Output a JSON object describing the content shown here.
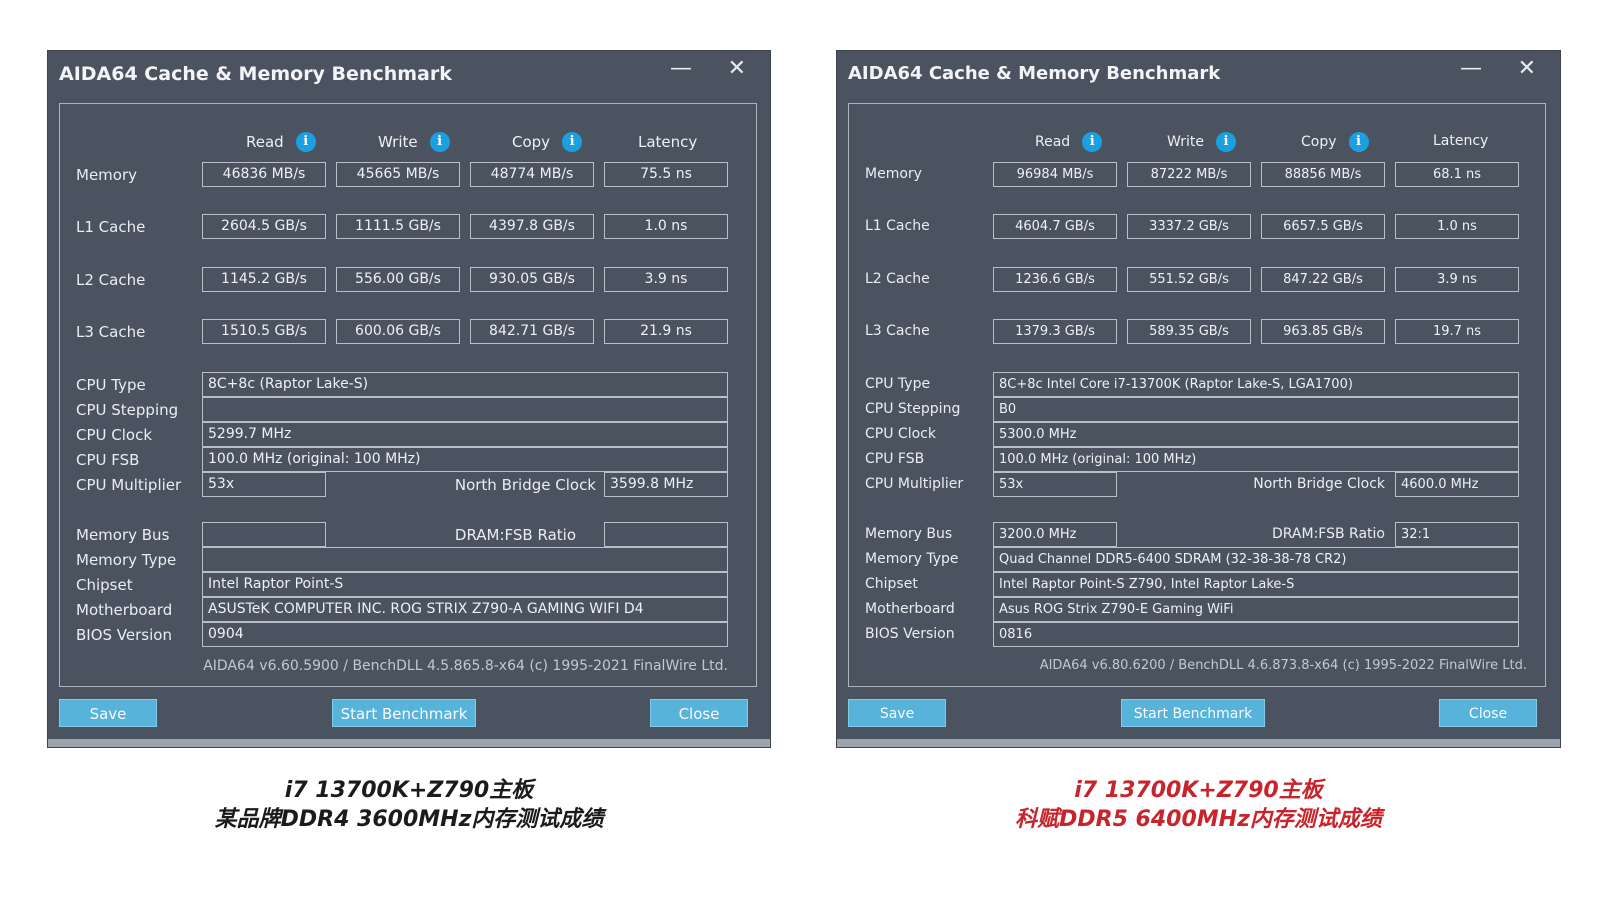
{
  "windows": [
    {
      "title": "AIDA64 Cache & Memory Benchmark",
      "min_glyph": "—",
      "close_glyph": "✕",
      "headers": [
        "Read",
        "Write",
        "Copy",
        "Latency"
      ],
      "info_glyph": "i",
      "rows": [
        {
          "label": "Memory",
          "values": [
            "46836 MB/s",
            "45665 MB/s",
            "48774 MB/s",
            "75.5 ns"
          ]
        },
        {
          "label": "L1 Cache",
          "values": [
            "2604.5 GB/s",
            "1111.5 GB/s",
            "4397.8 GB/s",
            "1.0 ns"
          ]
        },
        {
          "label": "L2 Cache",
          "values": [
            "1145.2 GB/s",
            "556.00 GB/s",
            "930.05 GB/s",
            "3.9 ns"
          ]
        },
        {
          "label": "L3 Cache",
          "values": [
            "1510.5 GB/s",
            "600.06 GB/s",
            "842.71 GB/s",
            "21.9 ns"
          ]
        }
      ],
      "cpu_type_label": "CPU Type",
      "cpu_type": "8C+8c   (Raptor Lake-S)",
      "cpu_stepping_label": "CPU Stepping",
      "cpu_stepping": "",
      "cpu_clock_label": "CPU Clock",
      "cpu_clock": "5299.7 MHz",
      "cpu_fsb_label": "CPU FSB",
      "cpu_fsb": "100.0 MHz  (original: 100 MHz)",
      "cpu_multiplier_label": "CPU Multiplier",
      "cpu_multiplier": "53x",
      "nb_clock_label": "North Bridge Clock",
      "nb_clock": "3599.8 MHz",
      "memory_bus_label": "Memory Bus",
      "memory_bus": "",
      "dram_ratio_label": "DRAM:FSB Ratio",
      "dram_ratio": "",
      "memory_type_label": "Memory Type",
      "memory_type": "",
      "chipset_label": "Chipset",
      "chipset": "Intel Raptor Point-S",
      "motherboard_label": "Motherboard",
      "motherboard": "ASUSTeK COMPUTER INC. ROG STRIX Z790-A GAMING WIFI D4",
      "bios_label": "BIOS Version",
      "bios": "0904",
      "version": "AIDA64 v6.60.5900 / BenchDLL 4.5.865.8-x64  (c) 1995-2021 FinalWire Ltd.",
      "buttons": {
        "save": "Save",
        "start": "Start Benchmark",
        "close": "Close"
      },
      "caption_line1": "i7 13700K+Z790主板",
      "caption_line2": "某品牌DDR4  3600MHz内存测试成绩"
    },
    {
      "title": "AIDA64 Cache & Memory Benchmark",
      "min_glyph": "—",
      "close_glyph": "✕",
      "headers": [
        "Read",
        "Write",
        "Copy",
        "Latency"
      ],
      "info_glyph": "i",
      "rows": [
        {
          "label": "Memory",
          "values": [
            "96984 MB/s",
            "87222 MB/s",
            "88856 MB/s",
            "68.1 ns"
          ]
        },
        {
          "label": "L1 Cache",
          "values": [
            "4604.7 GB/s",
            "3337.2 GB/s",
            "6657.5 GB/s",
            "1.0 ns"
          ]
        },
        {
          "label": "L2 Cache",
          "values": [
            "1236.6 GB/s",
            "551.52 GB/s",
            "847.22 GB/s",
            "3.9 ns"
          ]
        },
        {
          "label": "L3 Cache",
          "values": [
            "1379.3 GB/s",
            "589.35 GB/s",
            "963.85 GB/s",
            "19.7 ns"
          ]
        }
      ],
      "cpu_type_label": "CPU Type",
      "cpu_type": "8C+8c Intel Core i7-13700K  (Raptor Lake-S, LGA1700)",
      "cpu_stepping_label": "CPU Stepping",
      "cpu_stepping": "B0",
      "cpu_clock_label": "CPU Clock",
      "cpu_clock": "5300.0 MHz",
      "cpu_fsb_label": "CPU FSB",
      "cpu_fsb": "100.0 MHz  (original: 100 MHz)",
      "cpu_multiplier_label": "CPU Multiplier",
      "cpu_multiplier": "53x",
      "nb_clock_label": "North Bridge Clock",
      "nb_clock": "4600.0 MHz",
      "memory_bus_label": "Memory Bus",
      "memory_bus": "3200.0 MHz",
      "dram_ratio_label": "DRAM:FSB Ratio",
      "dram_ratio": "32:1",
      "memory_type_label": "Memory Type",
      "memory_type": "Quad Channel DDR5-6400 SDRAM  (32-38-38-78 CR2)",
      "chipset_label": "Chipset",
      "chipset": "Intel Raptor Point-S Z790, Intel Raptor Lake-S",
      "motherboard_label": "Motherboard",
      "motherboard": "Asus ROG Strix Z790-E Gaming WiFi",
      "bios_label": "BIOS Version",
      "bios": "0816",
      "version": "AIDA64 v6.80.6200 / BenchDLL 4.6.873.8-x64  (c) 1995-2022 FinalWire Ltd.",
      "buttons": {
        "save": "Save",
        "start": "Start Benchmark",
        "close": "Close"
      },
      "caption_line1": "i7 13700K+Z790主板",
      "caption_line2": "科赋DDR5  6400MHz内存测试成绩"
    }
  ],
  "colors": {
    "window_bg": "#4b5361",
    "button_bg": "#58b3da",
    "info_icon": "#1aa0e0",
    "caption_right": "#c8242b",
    "caption_left": "#1b1b1b"
  }
}
